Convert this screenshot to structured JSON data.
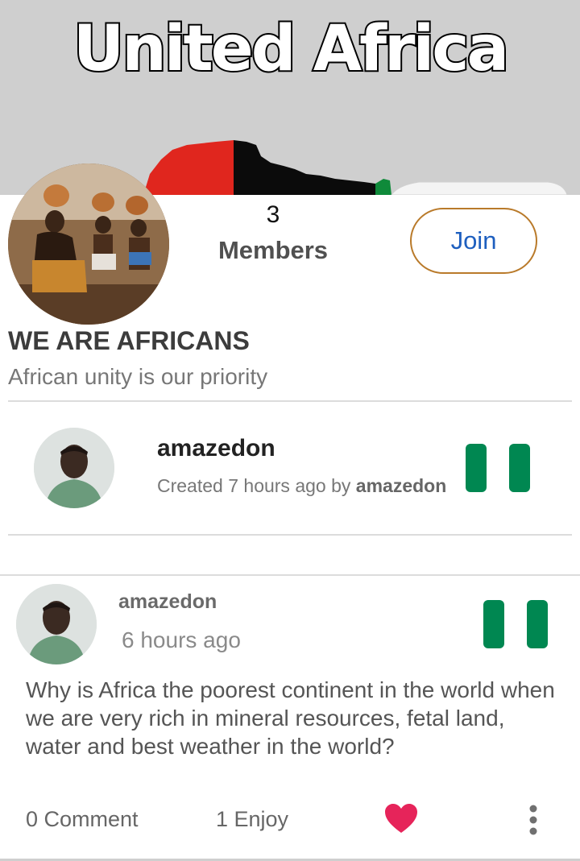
{
  "banner": {
    "title": "United Africa"
  },
  "group": {
    "member_count": "3",
    "member_label": "Members",
    "join_label": "Join",
    "name": "WE ARE AFRICANS",
    "description": "African unity is our priority"
  },
  "creator": {
    "username": "amazedon",
    "created_prefix": "Created 7 hours ago by",
    "created_by": "amazedon",
    "flag_icon": "nigeria-flag-icon"
  },
  "post": {
    "author": "amazedon",
    "time": "6 hours ago",
    "body": "Why is Africa the poorest continent in the world when we are very rich in mineral resources, fetal land, water and best weather in the world?",
    "comment_label": "0 Comment",
    "enjoy_label": "1 Enjoy",
    "flag_icon": "nigeria-flag-icon",
    "like_icon": "heart-icon",
    "more_icon": "more-vertical-icon"
  },
  "colors": {
    "flag_green": "#008751",
    "join_border": "#b97a2a",
    "join_text": "#1e5fbf",
    "heart": "#e6245a"
  }
}
